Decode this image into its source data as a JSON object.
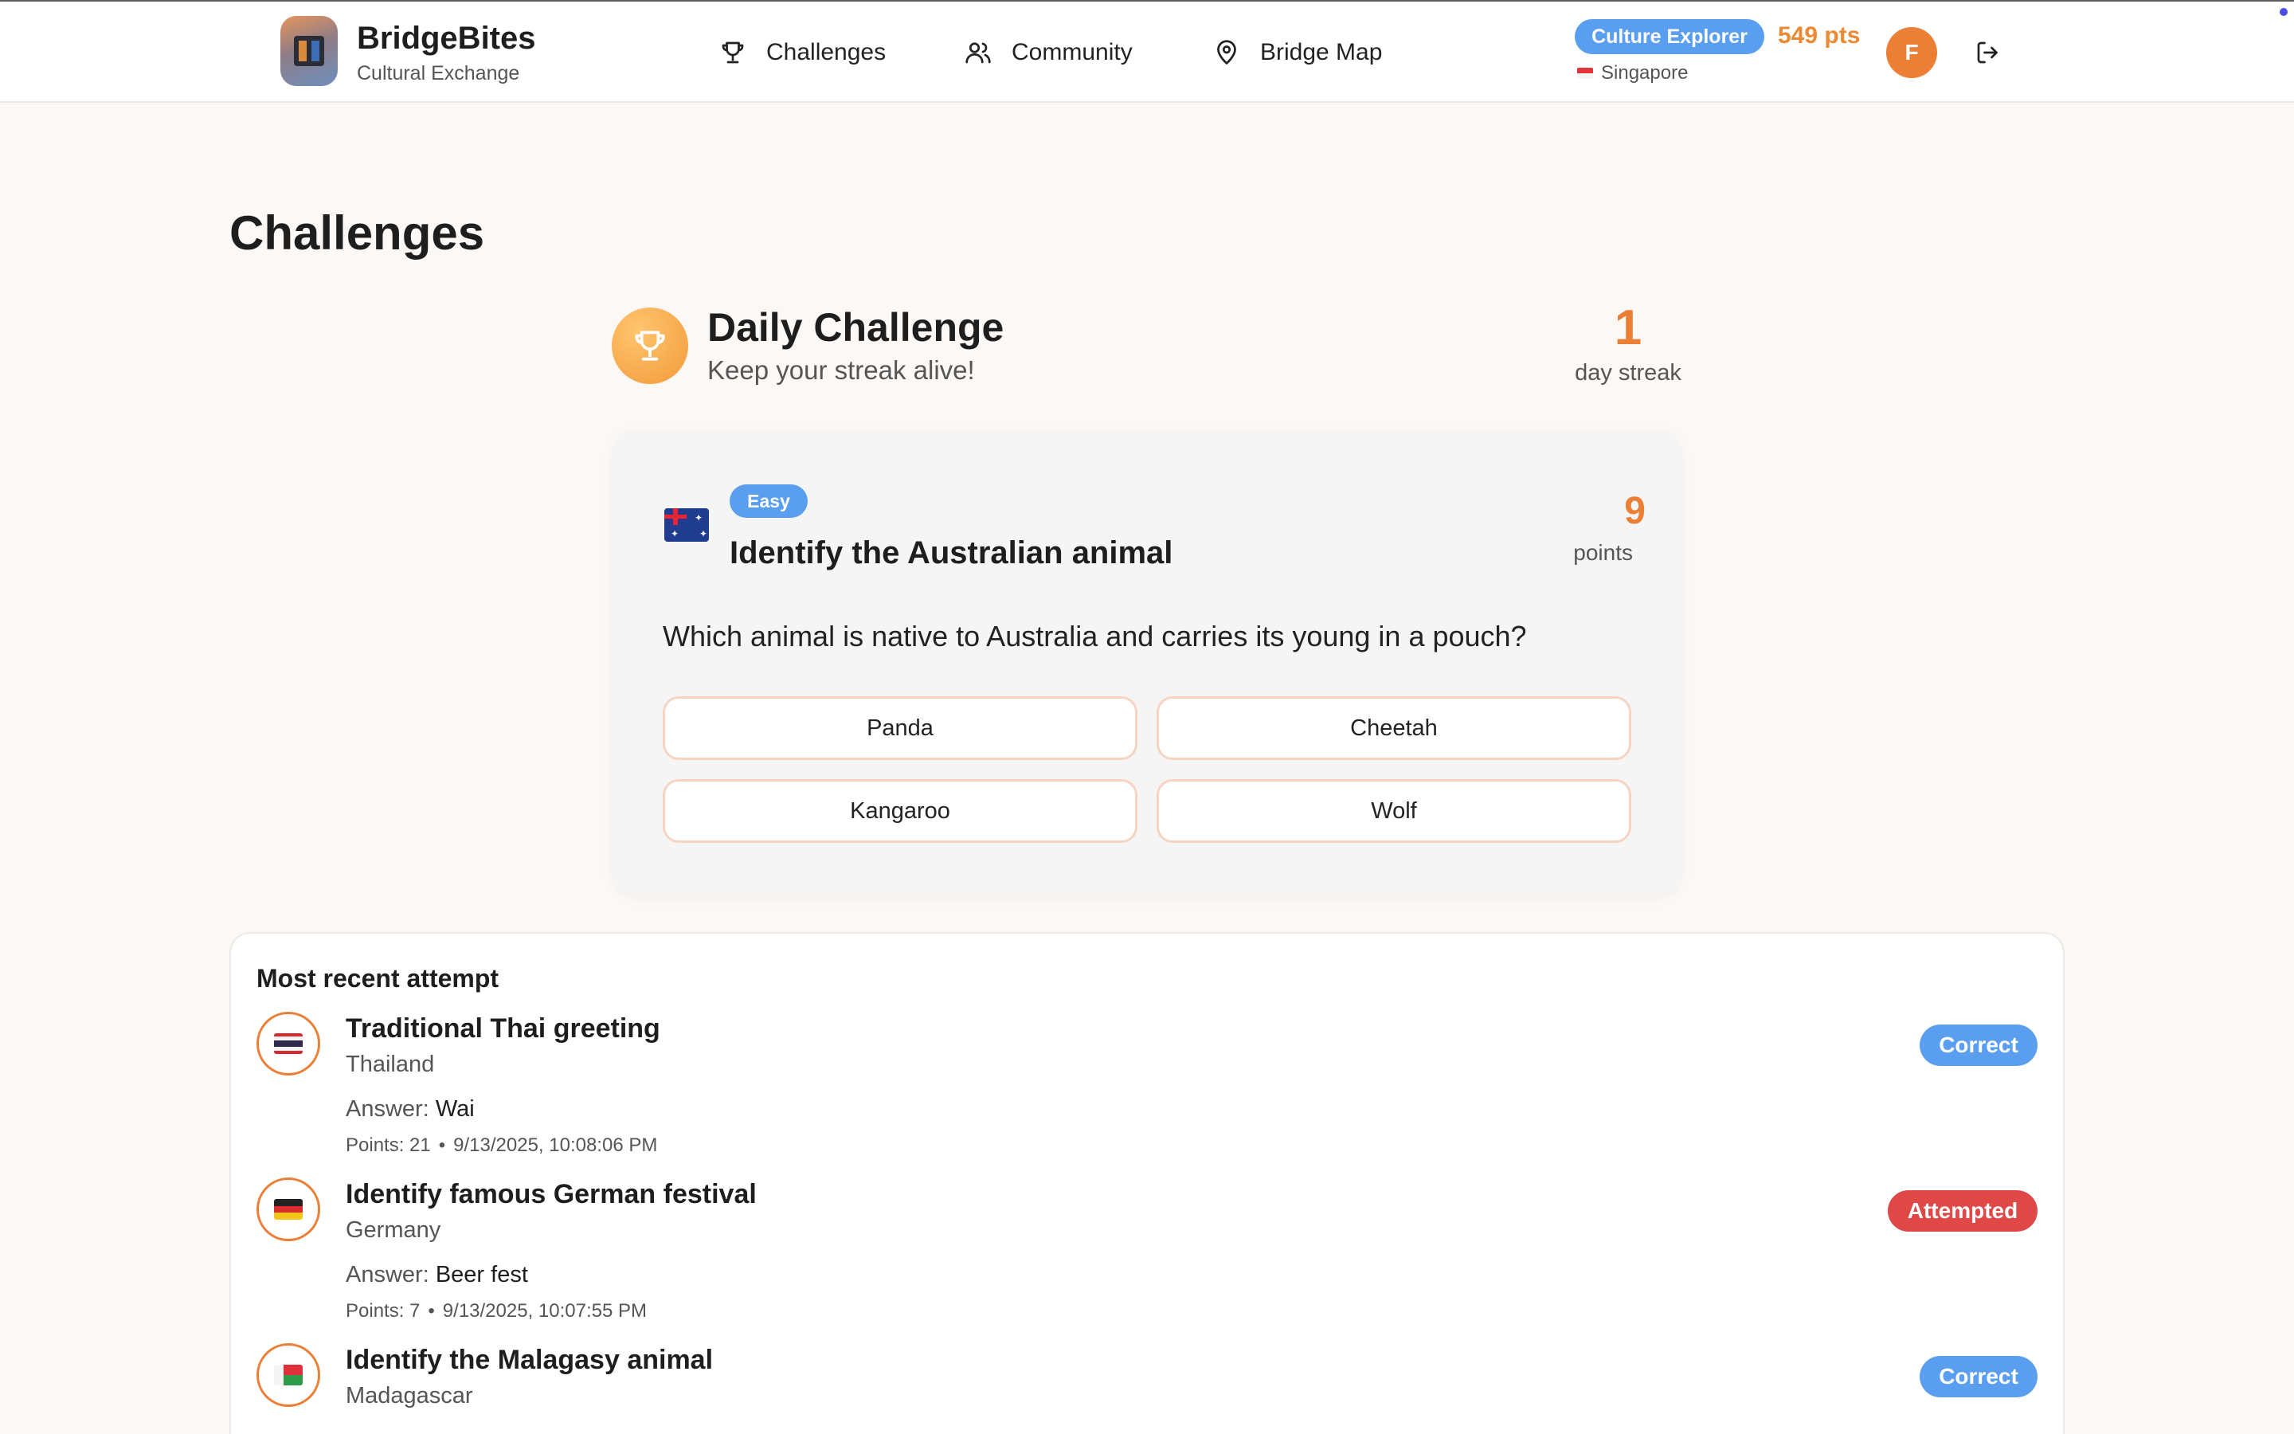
{
  "app": {
    "brand_name": "BridgeBites",
    "brand_sub": "Cultural Exchange"
  },
  "nav": {
    "challenges": "Challenges",
    "community": "Community",
    "map": "Bridge Map"
  },
  "user": {
    "rank": "Culture Explorer",
    "points": "549 pts",
    "location": "Singapore",
    "avatar_initial": "F"
  },
  "icons": {
    "nav_challenges": "trophy-icon",
    "nav_community": "users-icon",
    "nav_map": "map-pin-icon",
    "logout": "logout-icon",
    "daily": "trophy-icon"
  },
  "colors": {
    "accent": "#ec7f36",
    "badge_blue": "#5a9ef0",
    "attempted_red": "#e04848"
  },
  "page_title": "Challenges",
  "daily": {
    "title": "Daily Challenge",
    "subtitle": "Keep your streak alive!",
    "streak_value": "1",
    "streak_label": "day streak"
  },
  "challenge": {
    "difficulty": "Easy",
    "country_flag": "Australia",
    "title": "Identify the Australian animal",
    "points": "9",
    "points_label": "points",
    "question": "Which animal is native to Australia and carries its young in a pouch?",
    "options": [
      "Panda",
      "Cheetah",
      "Kangaroo",
      "Wolf"
    ]
  },
  "recent": {
    "title": "Most recent attempt",
    "answer_label": "Answer:",
    "attempts": [
      {
        "title": "Traditional Thai greeting",
        "country": "Thailand",
        "answer": "Wai",
        "points": "Points: 21",
        "sep": "•",
        "timestamp": "9/13/2025, 10:08:06 PM",
        "status": "Correct"
      },
      {
        "title": "Identify famous German festival",
        "country": "Germany",
        "answer": "Beer fest",
        "points": "Points: 7",
        "sep": "•",
        "timestamp": "9/13/2025, 10:07:55 PM",
        "status": "Attempted"
      },
      {
        "title": "Identify the Malagasy animal",
        "country": "Madagascar",
        "status": "Correct"
      }
    ]
  }
}
